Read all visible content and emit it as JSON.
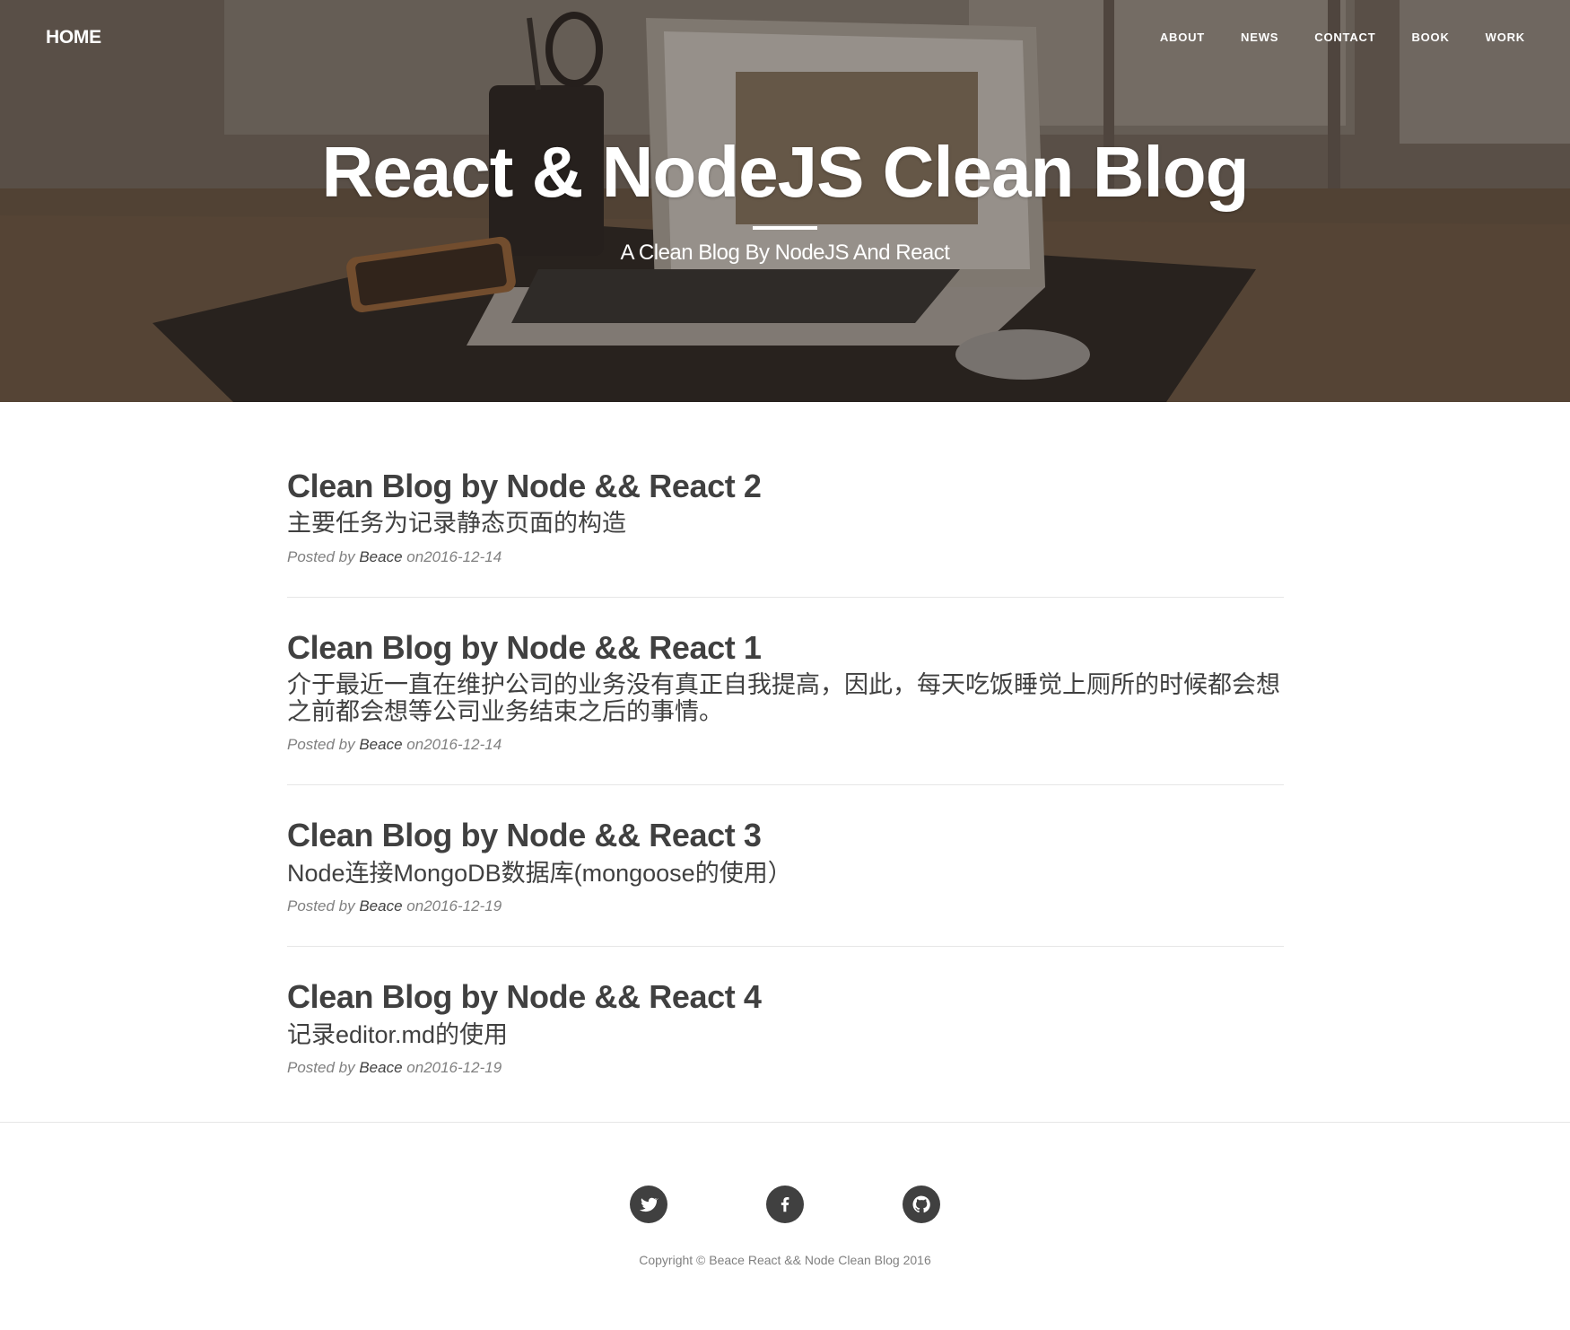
{
  "nav": {
    "brand": "HOME",
    "links": [
      "ABOUT",
      "NEWS",
      "CONTACT",
      "BOOK",
      "WORK"
    ]
  },
  "hero": {
    "title": "React & NodeJS Clean Blog",
    "subtitle": "A Clean Blog By NodeJS And React"
  },
  "posts": [
    {
      "title": "Clean Blog by Node && React 2",
      "subtitle": "主要任务为记录静态页面的构造",
      "meta_prefix": "Posted by",
      "author": "Beace",
      "meta_on": "on2016-12-14"
    },
    {
      "title": "Clean Blog by Node && React 1",
      "subtitle": "介于最近一直在维护公司的业务没有真正自我提高，因此，每天吃饭睡觉上厕所的时候都会想之前都会想等公司业务结束之后的事情。",
      "meta_prefix": "Posted by",
      "author": "Beace",
      "meta_on": "on2016-12-14"
    },
    {
      "title": "Clean Blog by Node && React 3",
      "subtitle": "Node连接MongoDB数据库(mongoose的使用）",
      "meta_prefix": "Posted by",
      "author": "Beace",
      "meta_on": "on2016-12-19"
    },
    {
      "title": "Clean Blog by Node && React 4",
      "subtitle": "记录editor.md的使用",
      "meta_prefix": "Posted by",
      "author": "Beace",
      "meta_on": "on2016-12-19"
    }
  ],
  "footer": {
    "social": [
      "twitter-icon",
      "facebook-icon",
      "github-icon"
    ],
    "copyright": "Copyright © Beace React && Node Clean Blog 2016"
  },
  "colors": {
    "text": "#404040",
    "meta": "#808080",
    "rule": "#e6e6e6",
    "hero_overlay": "#3f352d"
  }
}
